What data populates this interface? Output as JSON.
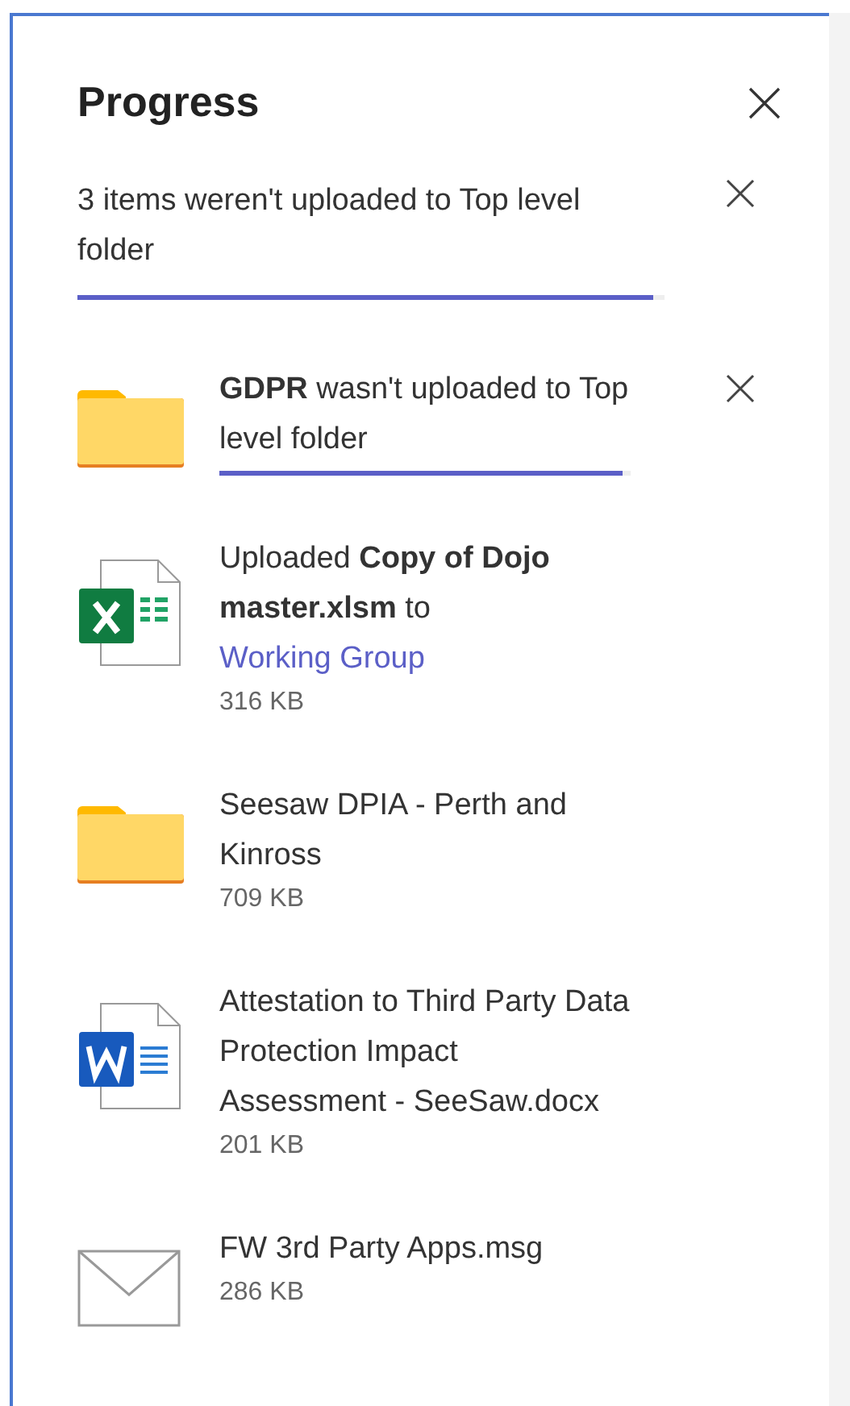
{
  "panel": {
    "title": "Progress"
  },
  "summary": {
    "text": "3 items weren't uploaded to Top level folder",
    "level": 0.98
  },
  "items": [
    {
      "kind": "folder",
      "message": "**GDPR** wasn't uploaded to Top level folder",
      "level": 0.98,
      "dismissable": true
    },
    {
      "kind": "excel",
      "message": "Uploaded **Copy of Dojo master.xlsm** to",
      "link": "Working Group",
      "size": "316 KB",
      "dismissable": false
    },
    {
      "kind": "folder",
      "message": "Seesaw DPIA - Perth and Kinross",
      "size": "709 KB",
      "dismissable": false
    },
    {
      "kind": "word",
      "message": "Attestation to Third Party Data Protection Impact Assessment - SeeSaw.docx",
      "size": "201 KB",
      "dismissable": false
    },
    {
      "kind": "mail",
      "message": "FW 3rd Party Apps.msg",
      "size": "286 KB",
      "dismissable": false
    }
  ]
}
